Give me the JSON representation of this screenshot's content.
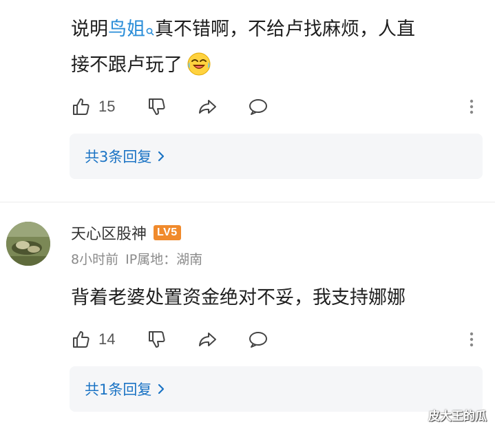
{
  "comments": [
    {
      "text_before": "说明",
      "mention": "鸟姐",
      "text_after": "真不错啊，不给卢找麻烦，人直",
      "line2": "接不跟卢玩了",
      "emoji": "laughing-crying-emoji",
      "likes": "15",
      "replies_label": "共3条回复"
    },
    {
      "username": "天心区股神",
      "level": "LV5",
      "time": "8小时前",
      "location": "IP属地：湖南",
      "text": "背着老婆处置资金绝对不妥，我支持娜娜",
      "likes": "14",
      "replies_label": "共1条回复"
    }
  ],
  "watermark": "皮大王的瓜",
  "colors": {
    "mention": "#2a8dd8",
    "reply_link": "#1a73c4",
    "level_badge": "#f08a2c",
    "reply_box_bg": "#f5f6f8"
  },
  "icons": [
    "like-icon",
    "dislike-icon",
    "share-icon",
    "comment-icon",
    "more-icon",
    "chevron-right-icon",
    "search-mark-icon"
  ]
}
